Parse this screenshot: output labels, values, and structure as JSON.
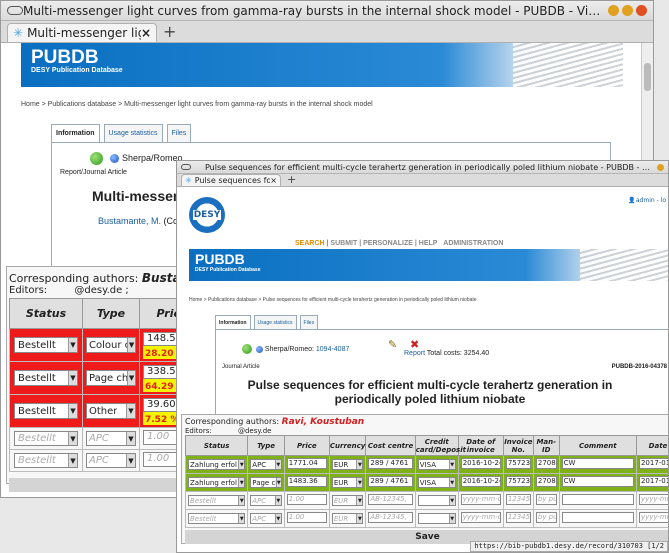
{
  "back_window": {
    "title": "Multi-messenger light curves from gamma-ray bursts in the internal shock model - PUBDB - Vimperator (Private Browsing)",
    "tab_label": "Multi-messenger light...",
    "banner_title": "PUBDB",
    "banner_subtitle": "DESY Publication Database",
    "breadcrumb": "Home > Publications database > Multi-messenger light curves from gamma-ray bursts in the internal shock model",
    "tabs": [
      "Information",
      "Usage statistics",
      "Files"
    ],
    "sherpa_label": "Sherpa/Romeo",
    "doc_type": "Report/Journal Article",
    "heading": "Multi-messeng",
    "author": "Bustamante, M.",
    "author_suffix": "(Cor",
    "corresponding_label": "Corresponding authors:",
    "corresponding_author": "Bustamante, I",
    "editors_label": "Editors:",
    "editors_value": "@desy.de ;",
    "columns": [
      "Status",
      "Type",
      "Price"
    ],
    "rows": [
      {
        "status": "Bestellt",
        "type": "Colour cl",
        "price": "148.50",
        "pct": "28.20 %"
      },
      {
        "status": "Bestellt",
        "type": "Page cha",
        "price": "338.58",
        "pct": "64.29 %"
      },
      {
        "status": "Bestellt",
        "type": "Other",
        "price": "39.60",
        "pct": "7.52 %"
      }
    ],
    "empty_rows": [
      {
        "status": "Bestellt",
        "type": "APC",
        "price": "1.00"
      },
      {
        "status": "Bestellt",
        "type": "APC",
        "price": "1.00"
      }
    ]
  },
  "front_window": {
    "title": "Pulse sequences for efficient multi-cycle terahertz generation in periodically poled lithium niobate - PUBDB - Vimperator (Private Browsing)",
    "tab_label": "Pulse sequences for e...",
    "logo_text": "DESY",
    "user": "admin - lo",
    "nav": [
      "SEARCH",
      "SUBMIT",
      "PERSONALIZE",
      "HELP",
      "ADMINISTRATION"
    ],
    "banner_title": "PUBDB",
    "banner_subtitle": "DESY Publication Database",
    "breadcrumb": "Home > Publications database > Pulse sequences for efficient multi-cycle terahertz generation in periodically poled lithium niobate",
    "tabs": [
      "Information",
      "Usage statistics",
      "Files"
    ],
    "sherpa_label": "Sherpa/Romeo:",
    "sherpa_id": "1094-4087",
    "report_link": "Report",
    "total_costs": "Total costs: 3254.40",
    "doc_type": "Journal Article",
    "record_id": "PUBDB-2016-04378",
    "heading": "Pulse sequences for efficient multi-cycle terahertz generation in periodically poled lithium niobate",
    "corresponding_label": "Corresponding authors:",
    "corresponding_author": "Ravi, Koustuban",
    "editors_label": "Editors:",
    "editors_value": "@desy.de",
    "columns": [
      "Status",
      "Type",
      "Price",
      "Currency",
      "Cost centre",
      "Credit card/Deposit",
      "Date of invoice",
      "Invoice No.",
      "Man-ID",
      "Comment",
      "Date"
    ],
    "rows": [
      {
        "status": "Zahlung erfol",
        "type": "APC",
        "price": "1771.04",
        "currency": "EUR",
        "cost": "289 / 4761",
        "card": "VISA",
        "date": "2016-10-24",
        "invoice": "757236",
        "man": "27083",
        "comment": "CW",
        "date2": "2017-01-"
      },
      {
        "status": "Zahlung erfol",
        "type": "Page cha",
        "price": "1483.36",
        "currency": "EUR",
        "cost": "289 / 4761",
        "card": "VISA",
        "date": "2016-10-24",
        "invoice": "757236",
        "man": "27083",
        "comment": "CW",
        "date2": "2017-01-"
      }
    ],
    "empty_rows": [
      {
        "status": "Bestellt",
        "type": "APC",
        "price": "1.00",
        "currency": "EUR",
        "cost": "AB-12345,",
        "date": "yyyy-mm-dd",
        "invoice": "123456",
        "man": "by pub",
        "date2": "yyyy-mm-"
      },
      {
        "status": "Bestellt",
        "type": "APC",
        "price": "1.00",
        "currency": "EUR",
        "cost": "AB-12345,",
        "date": "yyyy-mm-dd",
        "invoice": "123456",
        "man": "by pub",
        "date2": "yyyy-mm-"
      }
    ],
    "save_label": "Save",
    "status_url": "https://bib-pubdb1.desy.de/record/310703 [1/2"
  },
  "colors": {
    "banner": "#0a6fc1",
    "red_row": "#ef1a1a",
    "green_row": "#7fb11a",
    "pct_yellow": "#f4f400",
    "nav_orange": "#e68a00"
  }
}
